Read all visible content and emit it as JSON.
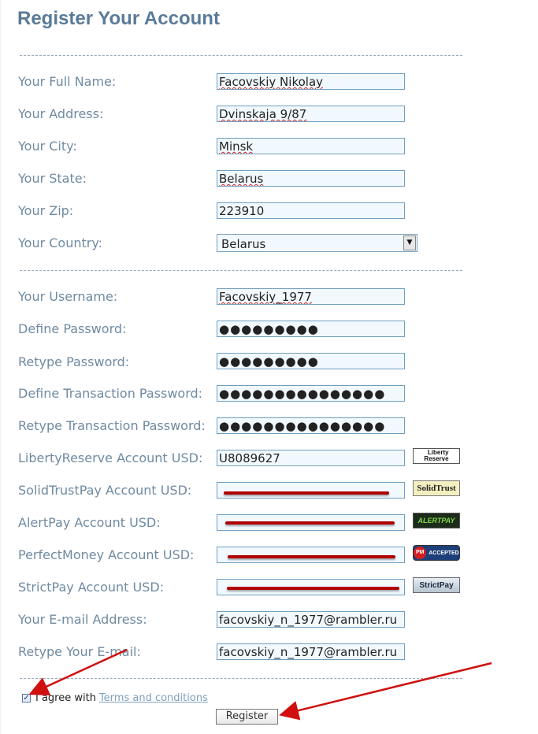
{
  "page": {
    "title": "Register Your Account"
  },
  "fields": [
    {
      "label": "Your Full Name:",
      "value": "Facovskiy Nikolay",
      "spell": true
    },
    {
      "label": "Your Address:",
      "value": "Dvinskaja 9/87",
      "spell": true
    },
    {
      "label": "Your City:",
      "value": "Minsk",
      "spell": true
    },
    {
      "label": "Your State:",
      "value": "Belarus",
      "spell": true
    },
    {
      "label": "Your Zip:",
      "value": "223910",
      "spell": false
    }
  ],
  "country": {
    "label": "Your Country:",
    "value": "Belarus"
  },
  "account": [
    {
      "label": "Your Username:",
      "value": "Facovskiy_1977"
    },
    {
      "label": "Define Password:",
      "value": "●●●●●●●●●"
    },
    {
      "label": "Retype Password:",
      "value": "●●●●●●●●●"
    },
    {
      "label": "Define Transaction Password:",
      "value": "●●●●●●●●●●●●●●●"
    },
    {
      "label": "Retype Transaction Password:",
      "value": "●●●●●●●●●●●●●●●"
    }
  ],
  "payment": [
    {
      "label": "LibertyReserve Account USD:",
      "value": "U8089627",
      "badge": "Liberty Reserve"
    },
    {
      "label": "SolidTrustPay Account USD:",
      "value": "",
      "badge": "SolidTrust"
    },
    {
      "label": "AlertPay Account USD:",
      "value": "",
      "badge": "ALERTPAY"
    },
    {
      "label": "PerfectMoney Account USD:",
      "value": "",
      "badge": "ACCEPTED"
    },
    {
      "label": "StrictPay Account USD:",
      "value": "",
      "badge": "StrictPay"
    }
  ],
  "email": [
    {
      "label": "Your E-mail Address:",
      "value": "facovskiy_n_1977@rambler.ru"
    },
    {
      "label": "Retype Your E-mail:",
      "value": "facovskiy_n_1977@rambler.ru"
    }
  ],
  "agree": {
    "checked": true,
    "text": "I agree with",
    "link": "Terms and conditions"
  },
  "submit": {
    "label": "Register"
  },
  "badges": {
    "liberty_line1": "Liberty",
    "liberty_line2": "Reserve",
    "pm_logo": "PM"
  },
  "colors": {
    "title": "#5a7a99",
    "label": "#6f8aa2",
    "input_border": "#6f9fc0",
    "input_bg": "#f1f9ff",
    "annotation": "#b00000"
  }
}
